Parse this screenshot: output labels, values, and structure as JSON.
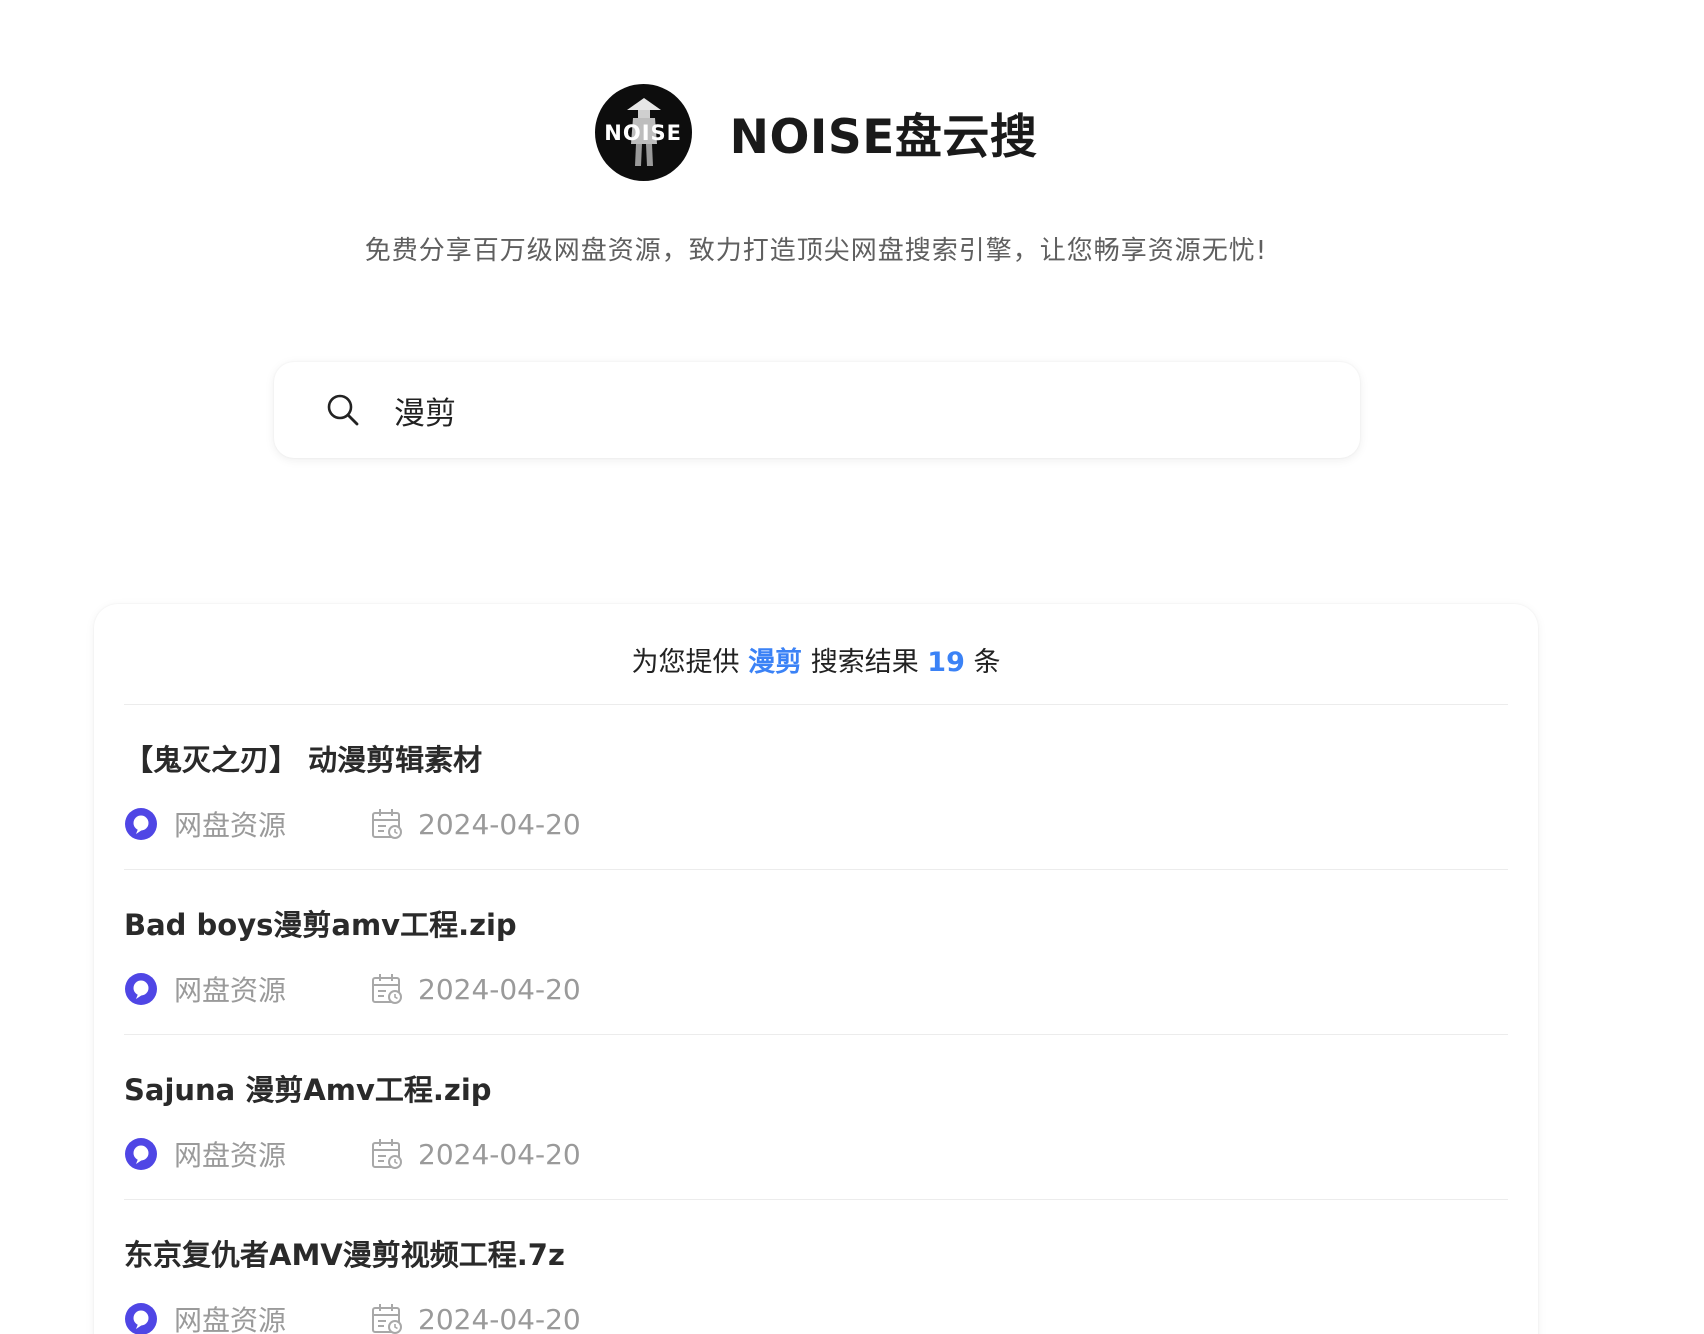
{
  "site": {
    "logo_text": "NOISE",
    "title": "NOISE盘云搜",
    "tagline": "免费分享百万级网盘资源，致力打造顶尖网盘搜索引擎，让您畅享资源无忧!"
  },
  "search": {
    "value": "漫剪",
    "icon": "search-icon"
  },
  "results": {
    "header_prefix": "为您提供",
    "keyword": "漫剪",
    "header_middle": "搜索结果",
    "count": "19",
    "header_suffix": "条",
    "items": [
      {
        "title": "【鬼灭之刃】 动漫剪辑素材",
        "source": "网盘资源",
        "date": "2024-04-20"
      },
      {
        "title": "Bad boys漫剪amv工程.zip",
        "source": "网盘资源",
        "date": "2024-04-20"
      },
      {
        "title": "Sajuna 漫剪Amv工程.zip",
        "source": "网盘资源",
        "date": "2024-04-20"
      },
      {
        "title": "东京复仇者AMV漫剪视频工程.7z",
        "source": "网盘资源",
        "date": "2024-04-20"
      }
    ]
  },
  "colors": {
    "accent": "#3b82f6",
    "source_icon": "#4f46e5",
    "muted_text": "#9a9a9a"
  }
}
